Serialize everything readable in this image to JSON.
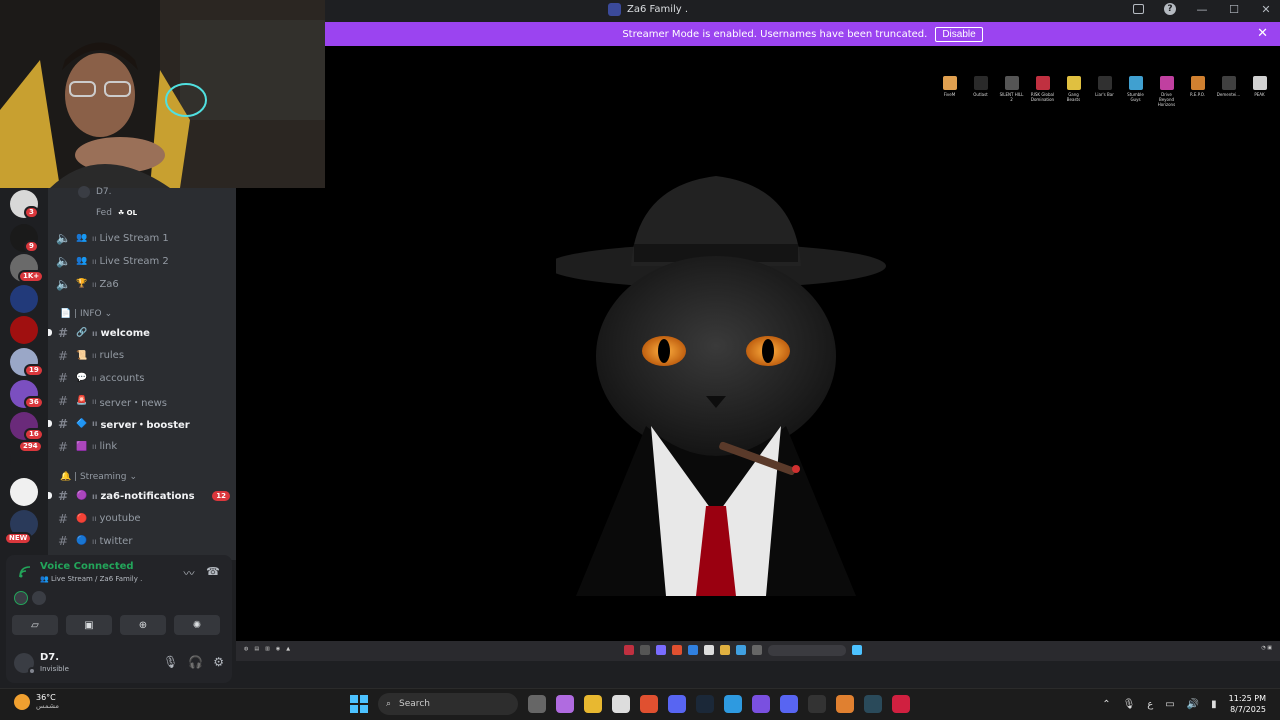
{
  "window": {
    "title": "Za6 Family ."
  },
  "banner": {
    "text": "Streamer Mode is enabled. Usernames have been truncated.",
    "disable_label": "Disable"
  },
  "rail": {
    "servers": [
      {
        "badge": "3",
        "color": "#d8d8d8"
      },
      {
        "badge": "9",
        "color": "#1a1a1a"
      },
      {
        "badge": "1K+",
        "color": "#6a6a6a"
      },
      {
        "badge": "",
        "color": "#223a7a"
      },
      {
        "badge": "",
        "color": "#a01010"
      },
      {
        "badge": "19",
        "color": "#9aa7c7"
      },
      {
        "badge": "36",
        "color": "#7b4fc0"
      },
      {
        "badge": "16",
        "color": "#6a2a7a"
      },
      {
        "badge": "294",
        "color": "#1e1f22"
      },
      {
        "badge": "",
        "color": "#f0f0f0"
      },
      {
        "badge": "",
        "color": "#2a3a5a"
      }
    ],
    "new_label": "NEW"
  },
  "channels": {
    "voice_users": [
      {
        "name": "D7."
      },
      {
        "name": "Fed",
        "tag": "OL"
      }
    ],
    "voice_channels": [
      {
        "emoji": "👥",
        "name": "Live Stream 1"
      },
      {
        "emoji": "👥",
        "name": "Live Stream 2"
      },
      {
        "emoji": "🏆",
        "name": "Za6"
      }
    ],
    "info_category": "📄 | INFO",
    "info_channels": [
      {
        "emoji": "🔗",
        "name": "welcome",
        "bright": true
      },
      {
        "emoji": "📜",
        "name": "rules",
        "bright": false
      },
      {
        "emoji": "💬",
        "name": "accounts",
        "bright": false
      },
      {
        "emoji": "🚨",
        "name": "server・news",
        "bright": false
      },
      {
        "emoji": "🔷",
        "name": "server・booster",
        "bright": true
      },
      {
        "emoji": "🟪",
        "name": "link",
        "bright": false
      }
    ],
    "streaming_category": "🔔 | Streaming",
    "streaming_channels": [
      {
        "emoji": "🟣",
        "name": "za6-notifications",
        "bright": true,
        "mention": "12"
      },
      {
        "emoji": "🔴",
        "name": "youtube",
        "bright": false
      },
      {
        "emoji": "🔵",
        "name": "twitter",
        "bright": false
      }
    ]
  },
  "voice_panel": {
    "status": "Voice Connected",
    "location": "Live Stream / Za6 Family ."
  },
  "user_panel": {
    "name": "D7.",
    "status": "Invisible"
  },
  "stream": {
    "desktop_icons": [
      {
        "label": "FiveM",
        "color": "#e0a050"
      },
      {
        "label": "Outlast",
        "color": "#2a2a2a"
      },
      {
        "label": "SILENT HILL 2",
        "color": "#555"
      },
      {
        "label": "RISK Global Domination",
        "color": "#c03040"
      },
      {
        "label": "Gang Beasts",
        "color": "#e0c040"
      },
      {
        "label": "Liar's Bar",
        "color": "#303030"
      },
      {
        "label": "Stumble Guys",
        "color": "#40a0d0"
      },
      {
        "label": "Drive Beyond Horizons",
        "color": "#c040a0"
      },
      {
        "label": "R.E.P.O.",
        "color": "#d08030"
      },
      {
        "label": "Dementei...",
        "color": "#404040"
      },
      {
        "label": "PEAK",
        "color": "#d0d0d0"
      }
    ]
  },
  "taskbar": {
    "temp": "36°C",
    "weather_desc": "مشمس",
    "search_label": "Search",
    "lang": "ع",
    "time": "11:25 PM",
    "date": "8/7/2025"
  }
}
